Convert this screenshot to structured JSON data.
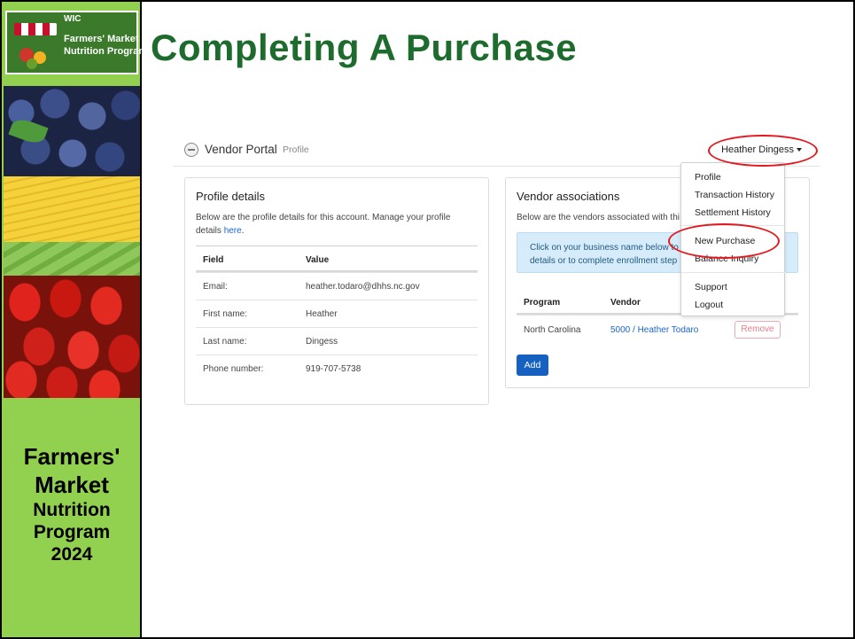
{
  "logo": {
    "wic": "WIC",
    "line1": "Farmers' Market",
    "line2": "Nutrition Program"
  },
  "sidebar": {
    "title_line1": "Farmers'",
    "title_line2": "Market",
    "title_line3": "Nutrition",
    "title_line4": "Program",
    "title_line5": "2024"
  },
  "slide_title": "Completing A Purchase",
  "navbar": {
    "brand": "Vendor Portal",
    "crumb": "Profile",
    "user": "Heather Dingess"
  },
  "profile": {
    "heading": "Profile details",
    "intro": "Below are the profile details for this account. Manage your profile details",
    "intro_link": "here",
    "intro_end": ".",
    "columns": [
      "Field",
      "Value"
    ],
    "rows": [
      {
        "field": "Email:",
        "value": "heather.todaro@dhhs.nc.gov"
      },
      {
        "field": "First name:",
        "value": "Heather"
      },
      {
        "field": "Last name:",
        "value": "Dingess"
      },
      {
        "field": "Phone number:",
        "value": "919-707-5738"
      }
    ]
  },
  "vendor": {
    "heading": "Vendor associations",
    "intro": "Below are the vendors associated with thi",
    "alert": "Click on your business name below to details or to complete enrollment step",
    "columns": [
      "Program",
      "Vendor"
    ],
    "rows": [
      {
        "program": "North Carolina",
        "vendor": "5000 / Heather Todaro",
        "action": "Remove"
      }
    ],
    "add_label": "Add"
  },
  "dropdown": {
    "items": [
      "Profile",
      "Transaction History",
      "Settlement History",
      "New Purchase",
      "Balance Inquiry",
      "Support",
      "Logout"
    ]
  },
  "colors": {
    "title_green": "#1e6b2e",
    "sidebar_green": "#92d050",
    "highlight_red": "#e4191f",
    "primary_blue": "#1560c0"
  }
}
